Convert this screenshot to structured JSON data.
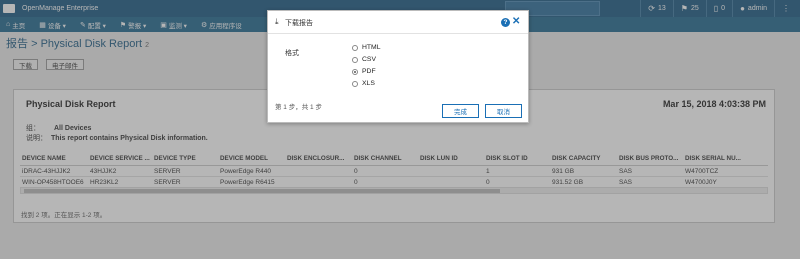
{
  "app": {
    "title": "OpenManage Enterprise",
    "top_right": {
      "refresh_count": "13",
      "jobs_count": "25",
      "alerts_count": "0",
      "user": "admin"
    }
  },
  "nav": {
    "items": [
      {
        "icon": "home-icon",
        "glyph": "⌂",
        "label": "主页"
      },
      {
        "icon": "devices-icon",
        "glyph": "▦",
        "label": "设备 ▾"
      },
      {
        "icon": "config-icon",
        "glyph": "✎",
        "label": "配置 ▾"
      },
      {
        "icon": "alerts-icon",
        "glyph": "⚑",
        "label": "警报 ▾"
      },
      {
        "icon": "monitor-icon",
        "glyph": "▣",
        "label": "监测 ▾"
      },
      {
        "icon": "app-settings-icon",
        "glyph": "⚙",
        "label": "应用程序设"
      }
    ]
  },
  "page": {
    "breadcrumb_root": "报告",
    "breadcrumb_sep": ">",
    "breadcrumb_current": "Physical Disk Report",
    "breadcrumb_count": "2",
    "download_button": "下载",
    "email_button": "电子邮件"
  },
  "report": {
    "title": "Physical Disk Report",
    "date": "Mar 15, 2018 4:03:38 PM",
    "group_label": "组：",
    "group_value": "All Devices",
    "desc_label": "说明：",
    "desc_value": "This report contains Physical Disk information.",
    "columns": [
      "DEVICE NAME",
      "DEVICE SERVICE ...",
      "DEVICE TYPE",
      "DEVICE MODEL",
      "DISK ENCLOSUR...",
      "DISK CHANNEL",
      "DISK LUN ID",
      "DISK SLOT ID",
      "DISK CAPACITY",
      "DISK BUS PROTO...",
      "DISK SERIAL NU..."
    ],
    "rows": [
      [
        "iDRAC-43HJJK2",
        "43HJJK2",
        "SERVER",
        "PowerEdge R440",
        "",
        "0",
        "",
        "1",
        "931 GB",
        "SAS",
        "W4700TCZ"
      ],
      [
        "WIN-OP458HTOOE6",
        "HR23KL2",
        "SERVER",
        "PowerEdge R6415",
        "",
        "0",
        "",
        "0",
        "931.52 GB",
        "SAS",
        "W4700J0Y"
      ]
    ],
    "footer": "找到 2 项。正在显示 1-2 项。"
  },
  "modal": {
    "title": "下载报告",
    "format_label": "格式",
    "options": [
      {
        "label": "HTML",
        "selected": false
      },
      {
        "label": "CSV",
        "selected": false
      },
      {
        "label": "PDF",
        "selected": true
      },
      {
        "label": "XLS",
        "selected": false
      }
    ],
    "step_text": "第 1 步，共 1 步",
    "finish_button": "完成",
    "cancel_button": "取消",
    "help_glyph": "?",
    "close_glyph": "✕",
    "download_glyph": "⤓"
  }
}
